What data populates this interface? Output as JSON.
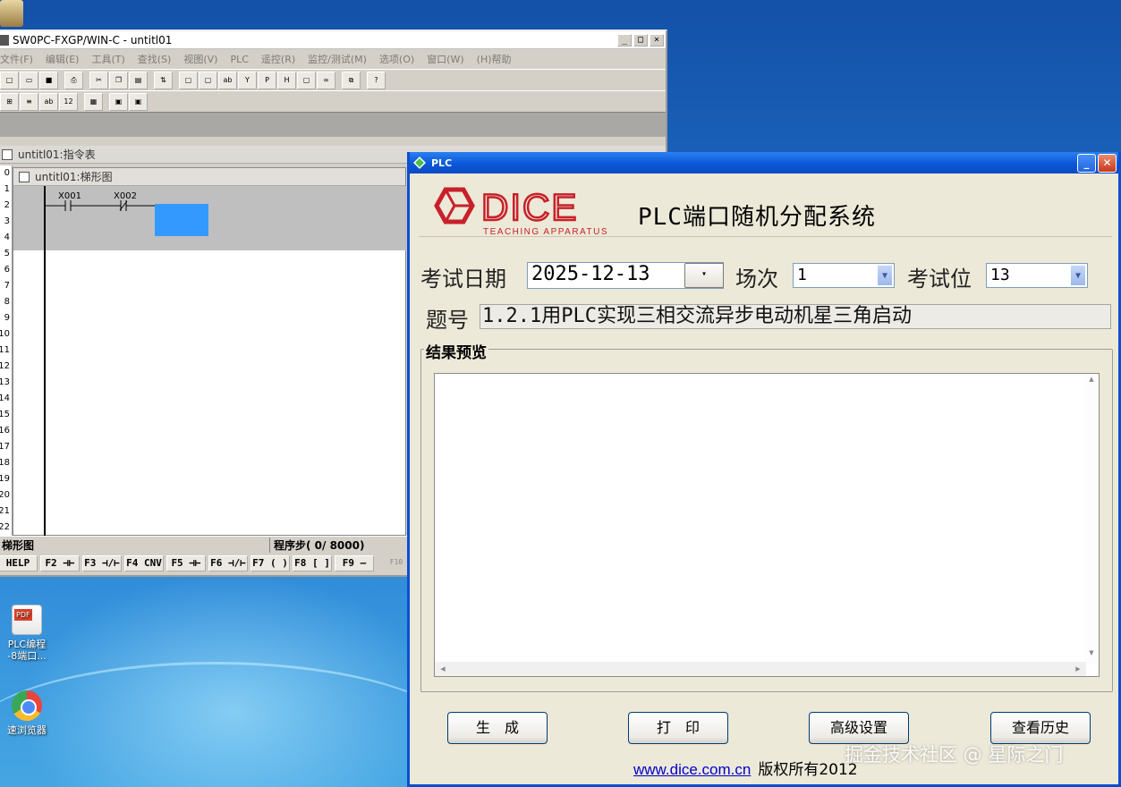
{
  "classic_window": {
    "title": "SW0PC-FXGP/WIN-C - untitl01",
    "buttons": [
      "_",
      "□",
      "×"
    ],
    "menu": [
      "文件(F)",
      "编辑(E)",
      "工具(T)",
      "查找(S)",
      "视图(V)",
      "PLC",
      "遥控(R)",
      "监控/测试(M)",
      "选项(O)",
      "窗口(W)",
      "(H)帮助"
    ],
    "instruction_list_title": "untitl01:指令表",
    "ladder_title": "untitl01:梯形图",
    "contacts": [
      "X001",
      "X002"
    ],
    "row_numbers": [
      "0",
      "1",
      "2",
      "3",
      "4",
      "5",
      "6",
      "7",
      "8",
      "9",
      "10",
      "11",
      "12",
      "13",
      "14",
      "15",
      "16",
      "17",
      "18",
      "19",
      "20",
      "21",
      "22"
    ],
    "status_left": "梯形图",
    "status_right": "程序步(   0/ 8000)",
    "fkeys": [
      "HELP",
      "F2 ⊣⊢",
      "F3 ⊣/⊢",
      "F4 CNV",
      "F5 ⊣⊢",
      "F6 ⊣/⊢",
      "F7 ( )",
      "F8 [ ]",
      "F9 —",
      "F10"
    ]
  },
  "desktop": {
    "icons": [
      {
        "label": "PLC编程\n-8端口...",
        "icon": "pdf-file-icon"
      },
      {
        "label": "速浏览器",
        "icon": "browser-icon"
      }
    ]
  },
  "plc_dialog": {
    "title": "PLC",
    "logo_text": "DICE",
    "logo_sub": "TEACHING APPARATUS",
    "system_title": "PLC端口随机分配系统",
    "exam_date_label": "考试日期",
    "exam_date_value": "2025-12-13",
    "session_label": "场次",
    "session_value": "1",
    "seat_label": "考试位",
    "seat_value": "13",
    "topic_label": "题号",
    "topic_value": "1.2.1用PLC实现三相交流异步电动机星三角启动",
    "result_group_label": "结果预览",
    "result_text": "",
    "buttons": {
      "generate": "生　成",
      "print": "打　印",
      "advanced": "高级设置",
      "history": "查看历史"
    },
    "footer_link": "www.dice.com.cn",
    "footer_text": "版权所有2012",
    "accent_color": "#c8202a"
  },
  "watermark": "掘金技术社区 @ 星际之门"
}
